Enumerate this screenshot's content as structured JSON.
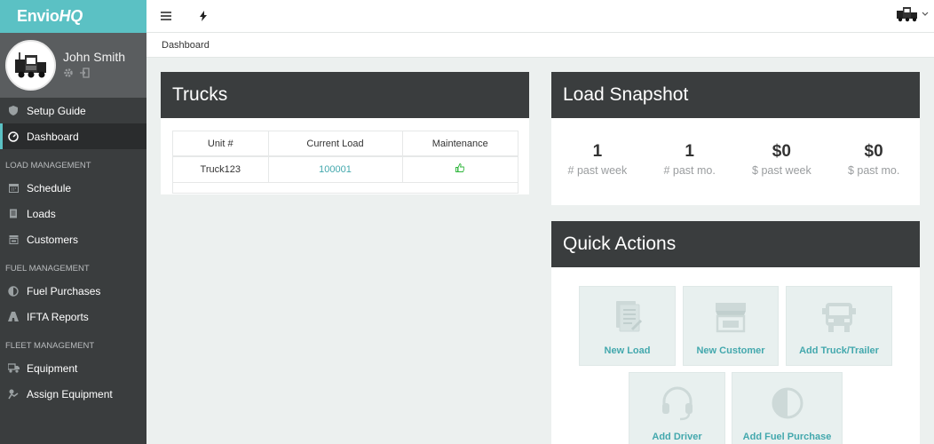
{
  "brand": {
    "name_main": "Envio",
    "name_accent": "HQ"
  },
  "user": {
    "name": "John Smith"
  },
  "sidebar": {
    "top_items": [
      {
        "label": "Setup Guide",
        "icon": "shield-icon"
      },
      {
        "label": "Dashboard",
        "icon": "dashboard-icon",
        "active": true
      }
    ],
    "load_header": "LOAD MANAGEMENT",
    "load_items": [
      {
        "label": "Schedule",
        "icon": "calendar-icon"
      },
      {
        "label": "Loads",
        "icon": "loads-icon"
      },
      {
        "label": "Customers",
        "icon": "customers-icon"
      }
    ],
    "fuel_header": "FUEL MANAGEMENT",
    "fuel_items": [
      {
        "label": "Fuel Purchases",
        "icon": "half-circle-icon"
      },
      {
        "label": "IFTA Reports",
        "icon": "road-icon"
      }
    ],
    "fleet_header": "FLEET MANAGEMENT",
    "fleet_items": [
      {
        "label": "Equipment",
        "icon": "truck-icon"
      },
      {
        "label": "Assign Equipment",
        "icon": "assign-icon"
      }
    ]
  },
  "breadcrumb": "Dashboard",
  "trucks": {
    "title": "Trucks",
    "columns": [
      "Unit #",
      "Current Load",
      "Maintenance"
    ],
    "rows": [
      {
        "unit": "Truck123",
        "current_load": "100001",
        "maintenance_icon": "thumbs-up-icon"
      }
    ]
  },
  "snapshot": {
    "title": "Load Snapshot",
    "stats": [
      {
        "value": "1",
        "label": "# past week"
      },
      {
        "value": "1",
        "label": "# past mo."
      },
      {
        "value": "$0",
        "label": "$ past week"
      },
      {
        "value": "$0",
        "label": "$ past mo."
      }
    ]
  },
  "quick_actions": {
    "title": "Quick Actions",
    "buttons": [
      {
        "label": "New Load",
        "icon": "document-icon"
      },
      {
        "label": "New Customer",
        "icon": "store-icon"
      },
      {
        "label": "Add Truck/Trailer",
        "icon": "truck-front-icon"
      },
      {
        "label": "Add Driver",
        "icon": "headset-icon"
      },
      {
        "label": "Add Fuel Purchase",
        "icon": "half-circle-icon"
      }
    ]
  },
  "colors": {
    "accent": "#5bc1c4",
    "sidebar": "#3a3d3e",
    "link": "#43a8ad",
    "success": "#2db53a"
  }
}
